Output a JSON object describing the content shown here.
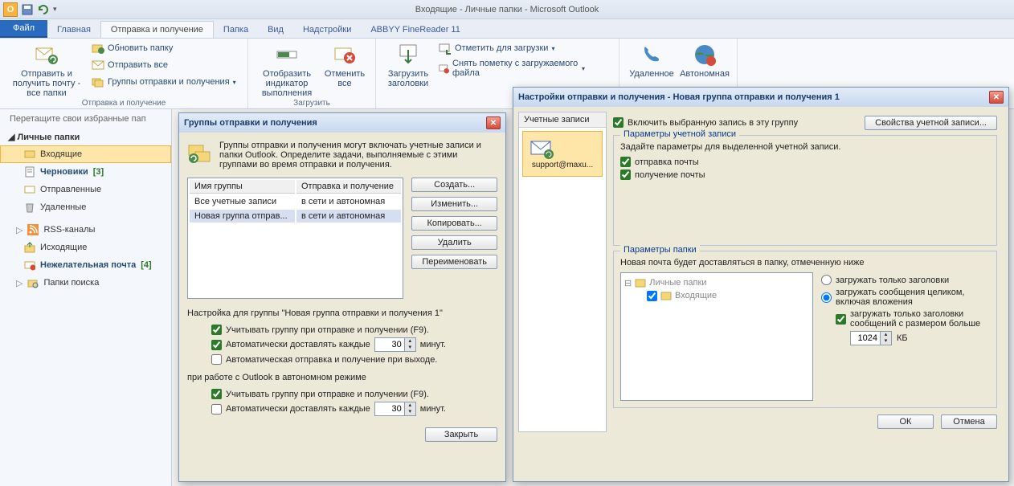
{
  "app": {
    "title": "Входящие - Личные папки - Microsoft Outlook"
  },
  "tabs": {
    "file": "Файл",
    "home": "Главная",
    "sendrecv": "Отправка и получение",
    "folder": "Папка",
    "view": "Вид",
    "addins": "Надстройки",
    "abbyy": "ABBYY FineReader 11"
  },
  "ribbon": {
    "send_all": "Отправить и получить почту - все папки",
    "update_folder": "Обновить папку",
    "send_all_sm": "Отправить все",
    "groups": "Группы отправки и получения",
    "grp1_label": "Отправка и получение",
    "show_progress": "Отобразить индикатор выполнения",
    "cancel_all": "Отменить все",
    "grp2_label": "Загрузить",
    "dl_headers": "Загрузить заголовки",
    "mark_dl": "Отметить для загрузки",
    "unmark": "Снять пометку с загружаемого файла",
    "remote": "Удаленное",
    "offline": "Автономная"
  },
  "nav": {
    "drag_hint": "Перетащите свои избранные пап",
    "account": "Личные папки",
    "inbox": "Входящие",
    "drafts": "Черновики",
    "drafts_count": "[3]",
    "sent": "Отправленные",
    "deleted": "Удаленные",
    "rss": "RSS-каналы",
    "outbox": "Исходящие",
    "junk": "Нежелательная почта",
    "junk_count": "[4]",
    "search": "Папки поиска"
  },
  "dlg1": {
    "title": "Группы отправки и получения",
    "intro": "Группы отправки и получения могут включать учетные записи и папки Outlook. Определите задачи, выполняемые с этими группами во время отправки и получения.",
    "col_name": "Имя группы",
    "col_sr": "Отправка и получение",
    "row1_name": "Все учетные записи",
    "row1_sr": "в сети и автономная",
    "row2_name": "Новая группа отправ...",
    "row2_sr": "в сети и автономная",
    "btn_new": "Создать...",
    "btn_edit": "Изменить...",
    "btn_copy": "Копировать...",
    "btn_del": "Удалить",
    "btn_ren": "Переименовать",
    "settings_for": "Настройка для группы \"Новая группа отправки и получения 1\"",
    "chk_include": "Учитывать группу при отправке и получении (F9).",
    "chk_auto": "Автоматически доставлять каждые",
    "auto_val": "30",
    "auto_unit": "минут.",
    "chk_exit": "Автоматическая отправка и получение при выходе.",
    "offline_label": "при работе с Outlook в автономном режиме",
    "chk_include2": "Учитывать группу при отправке и получении (F9).",
    "chk_auto2": "Автоматически доставлять каждые",
    "auto_val2": "30",
    "btn_close": "Закрыть"
  },
  "dlg2": {
    "title": "Настройки отправки и получения - Новая группа отправки и получения 1",
    "accounts_tab": "Учетные записи",
    "account_name": "support@maxu...",
    "chk_include": "Включить выбранную запись в эту группу",
    "btn_props": "Свойства учетной записи...",
    "fs_account": "Параметры учетной записи",
    "account_hint": "Задайте параметры для выделенной учетной записи.",
    "chk_send": "отправка почты",
    "chk_recv": "получение почты",
    "fs_folder": "Параметры папки",
    "folder_hint": "Новая почта будет доставляться в папку, отмеченную ниже",
    "tree_root": "Личные папки",
    "tree_inbox": "Входящие",
    "radio_headers": "загружать только заголовки",
    "radio_full": "загружать сообщения целиком, включая вложения",
    "chk_big": "загружать только заголовки сообщений с размером больше",
    "big_val": "1024",
    "big_unit": "КБ",
    "btn_ok": "ОК",
    "btn_cancel": "Отмена"
  }
}
